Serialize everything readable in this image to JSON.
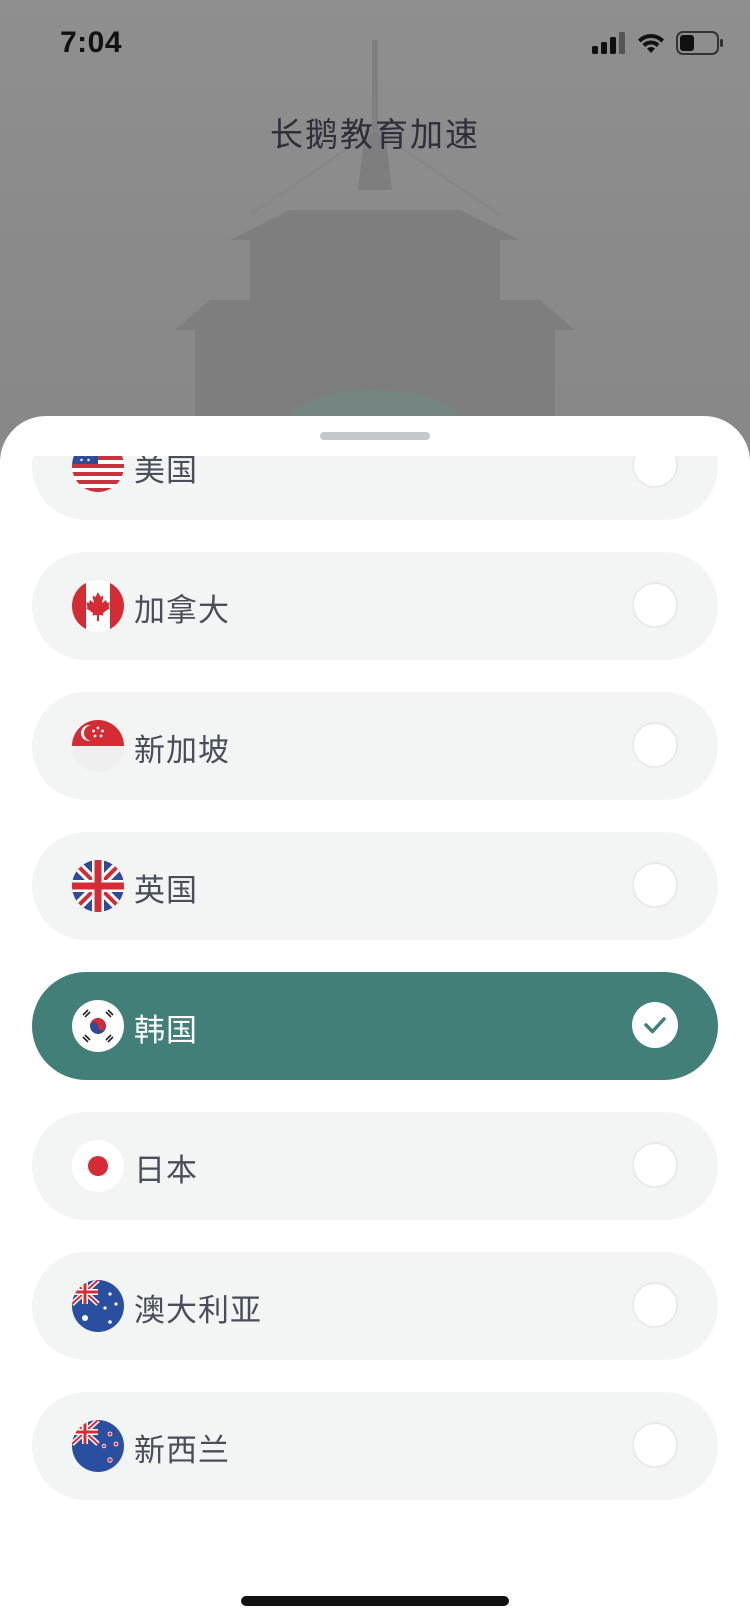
{
  "status_bar": {
    "time": "7:04",
    "icons": [
      "cellular-signal-icon",
      "wifi-icon",
      "battery-icon"
    ]
  },
  "app": {
    "title": "长鹅教育加速"
  },
  "colors": {
    "selected_bg": "#437f79",
    "row_bg": "#f3f4f4",
    "label": "#4a4e5a",
    "sheet_bg": "#ffffff",
    "backdrop": "#8c8c8c"
  },
  "regions": [
    {
      "label": "美国",
      "flag": "us-flag-icon",
      "selected": false
    },
    {
      "label": "加拿大",
      "flag": "canada-flag-icon",
      "selected": false
    },
    {
      "label": "新加坡",
      "flag": "singapore-flag-icon",
      "selected": false
    },
    {
      "label": "英国",
      "flag": "uk-flag-icon",
      "selected": false
    },
    {
      "label": "韩国",
      "flag": "korea-flag-icon",
      "selected": true
    },
    {
      "label": "日本",
      "flag": "japan-flag-icon",
      "selected": false
    },
    {
      "label": "澳大利亚",
      "flag": "australia-flag-icon",
      "selected": false
    },
    {
      "label": "新西兰",
      "flag": "new-zealand-flag-icon",
      "selected": false
    }
  ]
}
